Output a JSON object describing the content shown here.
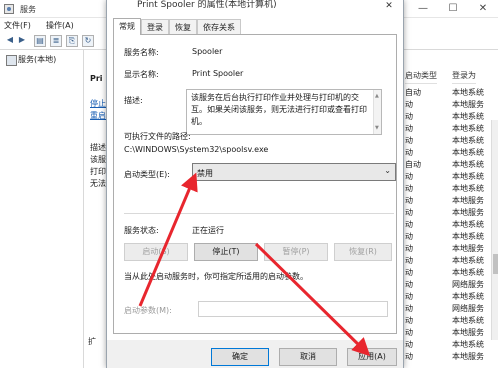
{
  "background": {
    "window_title": "服务",
    "menu": [
      "文件(F)",
      "操作(A)"
    ],
    "tree_item": "服务(本地)",
    "left_pane_fragments": [
      {
        "text": "Pri",
        "link": false
      },
      {
        "text": "停止",
        "link": true
      },
      {
        "text": "重启",
        "link": true
      },
      {
        "text": "描述",
        "link": false
      },
      {
        "text": "该服",
        "link": false
      },
      {
        "text": "打印",
        "link": false
      },
      {
        "text": "无法",
        "link": false
      }
    ],
    "columns": {
      "startup_type": "启动类型",
      "logon_as": "登录为"
    },
    "services": [
      {
        "startup": "自动",
        "logon": "本地系统"
      },
      {
        "startup": "动",
        "logon": "本地服务"
      },
      {
        "startup": "动",
        "logon": "本地系统"
      },
      {
        "startup": "动",
        "logon": "本地系统"
      },
      {
        "startup": "动",
        "logon": "本地系统"
      },
      {
        "startup": "动",
        "logon": "本地系统"
      },
      {
        "startup": "自动",
        "logon": "本地系统"
      },
      {
        "startup": "动",
        "logon": "本地系统"
      },
      {
        "startup": "动",
        "logon": "本地系统"
      },
      {
        "startup": "动",
        "logon": "本地服务"
      },
      {
        "startup": "动",
        "logon": "本地服务"
      },
      {
        "startup": "动",
        "logon": "本地系统"
      },
      {
        "startup": "动",
        "logon": "本地系统"
      },
      {
        "startup": "动",
        "logon": "本地服务"
      },
      {
        "startup": "动",
        "logon": "本地系统"
      },
      {
        "startup": "动",
        "logon": "本地系统"
      },
      {
        "startup": "动",
        "logon": "网络服务"
      },
      {
        "startup": "动",
        "logon": "本地系统"
      },
      {
        "startup": "动",
        "logon": "网络服务"
      },
      {
        "startup": "动",
        "logon": "本地系统"
      },
      {
        "startup": "动",
        "logon": "本地服务"
      },
      {
        "startup": "动",
        "logon": "本地系统"
      },
      {
        "startup": "动",
        "logon": "本地服务"
      }
    ],
    "bottom_tab": "扩"
  },
  "dialog": {
    "title": "Print Spooler 的属性(本地计算机)",
    "close_glyph": "✕",
    "tabs": [
      "常规",
      "登录",
      "恢复",
      "依存关系"
    ],
    "service_name_label": "服务名称:",
    "service_name": "Spooler",
    "display_name_label": "显示名称:",
    "display_name": "Print Spooler",
    "description_label": "描述:",
    "description": "该服务在后台执行打印作业并处理与打印机的交互。如果关闭该服务，则无法进行打印或查看打印机。",
    "exe_path_label": "可执行文件的路径:",
    "exe_path": "C:\\WINDOWS\\System32\\spoolsv.exe",
    "startup_type_label": "启动类型(E):",
    "startup_type_value": "禁用",
    "service_status_label": "服务状态:",
    "service_status_value": "正在运行",
    "buttons": {
      "start": "启动(S)",
      "stop": "停止(T)",
      "pause": "暂停(P)",
      "resume": "恢复(R)"
    },
    "hint": "当从此处启动服务时，你可指定所适用的启动参数。",
    "start_params_label": "启动参数(M):",
    "ok": "确定",
    "cancel": "取消",
    "apply": "应用(A)"
  },
  "colors": {
    "annotation_arrow": "#e8262e",
    "primary_border": "#0078d7",
    "link": "#1a5fb4"
  }
}
